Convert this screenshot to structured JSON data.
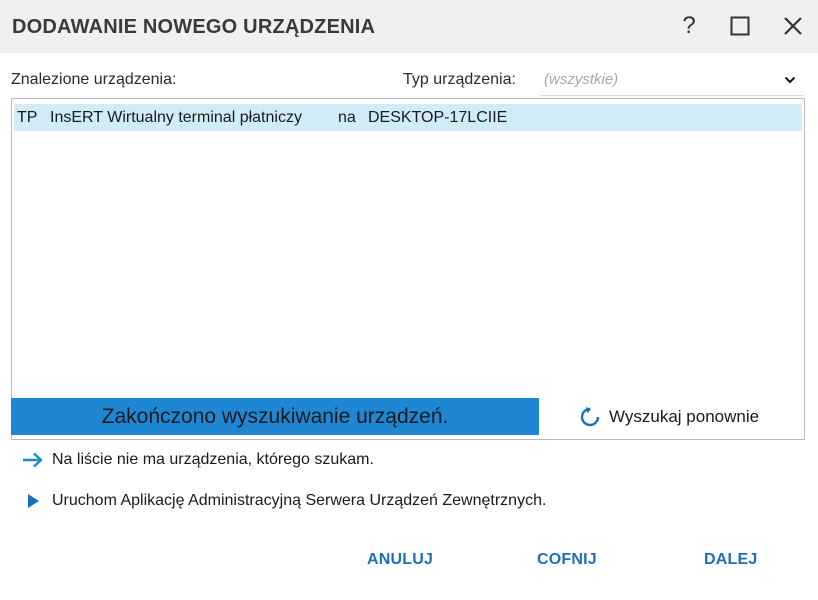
{
  "window": {
    "title": "DODAWANIE NOWEGO URZĄDZENIA",
    "help_label": "?"
  },
  "filters": {
    "found_label": "Znalezione urządzenia:",
    "type_label": "Typ urządzenia:",
    "type_value": "(wszystkie)"
  },
  "devices": [
    {
      "code": "TP",
      "name": "InsERT Wirtualny terminal płatniczy",
      "connector": "na",
      "host": "DESKTOP-17LCIIE"
    }
  ],
  "status": {
    "text": "Zakończono wyszukiwanie urządzeń.",
    "rescan_label": "Wyszukaj ponownie"
  },
  "links": {
    "not_found": "Na liście nie ma urządzenia, którego szukam.",
    "run_admin": "Uruchom Aplikację Administracyjną Serwera Urządzeń Zewnętrznych."
  },
  "buttons": {
    "cancel": "ANULUJ",
    "back": "COFNIJ",
    "next": "DALEJ"
  },
  "colors": {
    "accent": "#1f86d4",
    "selection": "#d1ecf7",
    "button_text": "#1d6fb5"
  }
}
